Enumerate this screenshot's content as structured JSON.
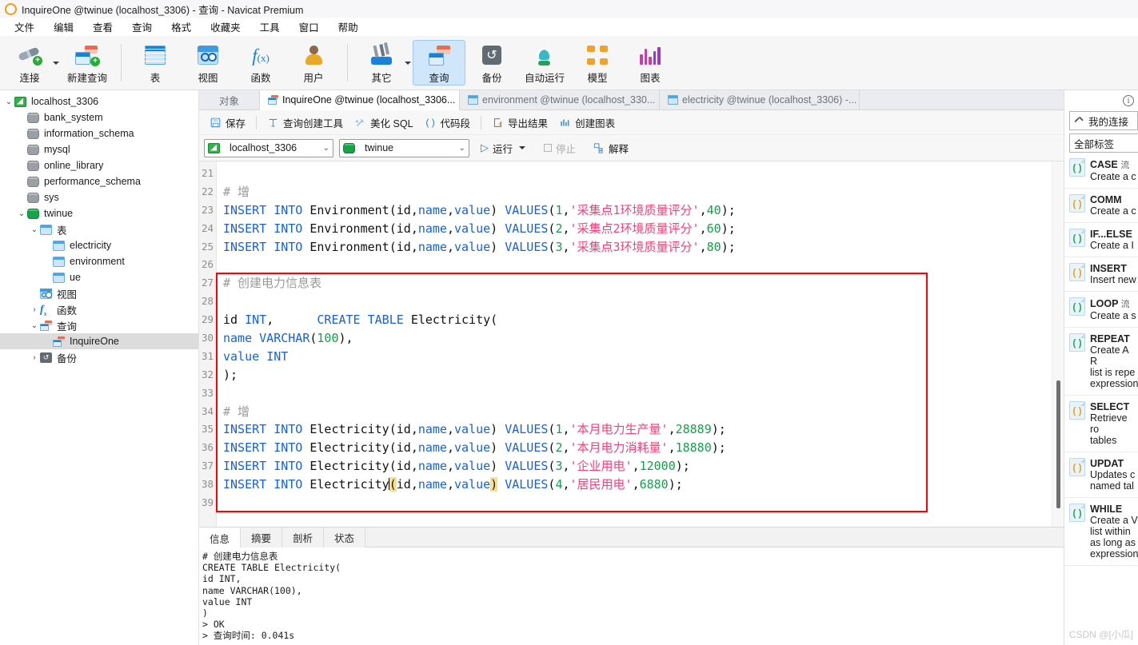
{
  "window": {
    "title": "InquireOne @twinue (localhost_3306) - 查询 - Navicat Premium",
    "logo_icon": "navicat-logo-icon"
  },
  "menubar": {
    "items": [
      {
        "label": "文件"
      },
      {
        "label": "编辑"
      },
      {
        "label": "查看"
      },
      {
        "label": "查询"
      },
      {
        "label": "格式"
      },
      {
        "label": "收藏夹"
      },
      {
        "label": "工具"
      },
      {
        "label": "窗口"
      },
      {
        "label": "帮助"
      }
    ]
  },
  "toolbar": {
    "items": [
      {
        "label": "连接",
        "icon": "connect-icon",
        "has_dropdown": true,
        "selected": false
      },
      {
        "label": "新建查询",
        "icon": "new-query-icon",
        "has_dropdown": false,
        "selected": false
      },
      {
        "label": "表",
        "icon": "table-icon",
        "has_dropdown": false,
        "selected": false
      },
      {
        "label": "视图",
        "icon": "view-icon",
        "has_dropdown": false,
        "selected": false
      },
      {
        "label": "函数",
        "icon": "function-icon",
        "has_dropdown": false,
        "selected": false
      },
      {
        "label": "用户",
        "icon": "user-icon",
        "has_dropdown": false,
        "selected": false
      },
      {
        "label": "其它",
        "icon": "other-tools-icon",
        "has_dropdown": true,
        "selected": false
      },
      {
        "label": "查询",
        "icon": "query-icon",
        "has_dropdown": false,
        "selected": true
      },
      {
        "label": "备份",
        "icon": "backup-icon",
        "has_dropdown": false,
        "selected": false
      },
      {
        "label": "自动运行",
        "icon": "automation-robot-icon",
        "has_dropdown": false,
        "selected": false
      },
      {
        "label": "模型",
        "icon": "model-icon",
        "has_dropdown": false,
        "selected": false
      },
      {
        "label": "图表",
        "icon": "chart-icon",
        "has_dropdown": false,
        "selected": false
      }
    ]
  },
  "sidebar": {
    "nodes": [
      {
        "label": "localhost_3306",
        "indent": 0,
        "twisty": "v",
        "icon": "connection-icon",
        "selected": false
      },
      {
        "label": "bank_system",
        "indent": 1,
        "twisty": "",
        "icon": "database-gray-icon",
        "selected": false
      },
      {
        "label": "information_schema",
        "indent": 1,
        "twisty": "",
        "icon": "database-gray-icon",
        "selected": false
      },
      {
        "label": "mysql",
        "indent": 1,
        "twisty": "",
        "icon": "database-gray-icon",
        "selected": false
      },
      {
        "label": "online_library",
        "indent": 1,
        "twisty": "",
        "icon": "database-gray-icon",
        "selected": false
      },
      {
        "label": "performance_schema",
        "indent": 1,
        "twisty": "",
        "icon": "database-gray-icon",
        "selected": false
      },
      {
        "label": "sys",
        "indent": 1,
        "twisty": "",
        "icon": "database-gray-icon",
        "selected": false
      },
      {
        "label": "twinue",
        "indent": 1,
        "twisty": "v",
        "icon": "database-green-icon",
        "selected": false
      },
      {
        "label": "表",
        "indent": 2,
        "twisty": "v",
        "icon": "table-folder-icon",
        "selected": false
      },
      {
        "label": "electricity",
        "indent": 3,
        "twisty": "",
        "icon": "table-icon",
        "selected": false
      },
      {
        "label": "environment",
        "indent": 3,
        "twisty": "",
        "icon": "table-icon",
        "selected": false
      },
      {
        "label": "ue",
        "indent": 3,
        "twisty": "",
        "icon": "table-icon",
        "selected": false
      },
      {
        "label": "视图",
        "indent": 2,
        "twisty": "",
        "icon": "view-folder-icon",
        "selected": false
      },
      {
        "label": "函数",
        "indent": 2,
        "twisty": ">",
        "icon": "function-folder-icon",
        "selected": false
      },
      {
        "label": "查询",
        "indent": 2,
        "twisty": "v",
        "icon": "query-folder-icon",
        "selected": false
      },
      {
        "label": "InquireOne",
        "indent": 3,
        "twisty": "",
        "icon": "query-icon",
        "selected": true
      },
      {
        "label": "备份",
        "indent": 2,
        "twisty": ">",
        "icon": "backup-folder-icon",
        "selected": false
      }
    ]
  },
  "tabs": {
    "object_tab": "对象",
    "items": [
      {
        "label": "InquireOne @twinue (localhost_3306...",
        "icon": "query-icon",
        "active": true
      },
      {
        "label": "environment @twinue (localhost_330...",
        "icon": "table-icon",
        "active": false
      },
      {
        "label": "electricity @twinue (localhost_3306) -...",
        "icon": "table-icon",
        "active": false
      }
    ]
  },
  "query_toolbar": {
    "buttons": [
      {
        "label": "保存",
        "icon": "save-icon"
      },
      {
        "label": "查询创建工具",
        "icon": "query-builder-icon"
      },
      {
        "label": "美化 SQL",
        "icon": "beautify-sql-icon"
      },
      {
        "label": "代码段",
        "icon": "code-snippet-icon"
      },
      {
        "label": "导出结果",
        "icon": "export-result-icon"
      },
      {
        "label": "创建图表",
        "icon": "create-chart-icon"
      }
    ],
    "connection_select": {
      "value": "localhost_3306",
      "icon": "connection-icon"
    },
    "database_select": {
      "value": "twinue",
      "icon": "database-green-icon"
    },
    "run_label": "运行",
    "stop_label": "停止",
    "explain_label": "解释"
  },
  "editor": {
    "first_line": 21,
    "last_line": 39,
    "lines": [
      {
        "n": 21,
        "tokens": []
      },
      {
        "n": 22,
        "tokens": [
          {
            "t": "# 增",
            "c": "cmt"
          }
        ]
      },
      {
        "n": 23,
        "tokens": [
          {
            "t": "INSERT INTO ",
            "c": "kw"
          },
          {
            "t": "Environment(",
            "c": "pl"
          },
          {
            "t": "id",
            "c": "pl"
          },
          {
            "t": ",",
            "c": "pl"
          },
          {
            "t": "name",
            "c": "col"
          },
          {
            "t": ",",
            "c": "pl"
          },
          {
            "t": "value",
            "c": "col"
          },
          {
            "t": ") ",
            "c": "pl"
          },
          {
            "t": "VALUES",
            "c": "kw"
          },
          {
            "t": "(",
            "c": "pl"
          },
          {
            "t": "1",
            "c": "num"
          },
          {
            "t": ",",
            "c": "pl"
          },
          {
            "t": "'采集点1环境质量评分'",
            "c": "str"
          },
          {
            "t": ",",
            "c": "pl"
          },
          {
            "t": "40",
            "c": "num"
          },
          {
            "t": ");",
            "c": "pl"
          }
        ]
      },
      {
        "n": 24,
        "tokens": [
          {
            "t": "INSERT INTO ",
            "c": "kw"
          },
          {
            "t": "Environment(",
            "c": "pl"
          },
          {
            "t": "id",
            "c": "pl"
          },
          {
            "t": ",",
            "c": "pl"
          },
          {
            "t": "name",
            "c": "col"
          },
          {
            "t": ",",
            "c": "pl"
          },
          {
            "t": "value",
            "c": "col"
          },
          {
            "t": ") ",
            "c": "pl"
          },
          {
            "t": "VALUES",
            "c": "kw"
          },
          {
            "t": "(",
            "c": "pl"
          },
          {
            "t": "2",
            "c": "num"
          },
          {
            "t": ",",
            "c": "pl"
          },
          {
            "t": "'采集点2环境质量评分'",
            "c": "str"
          },
          {
            "t": ",",
            "c": "pl"
          },
          {
            "t": "60",
            "c": "num"
          },
          {
            "t": ");",
            "c": "pl"
          }
        ]
      },
      {
        "n": 25,
        "tokens": [
          {
            "t": "INSERT INTO ",
            "c": "kw"
          },
          {
            "t": "Environment(",
            "c": "pl"
          },
          {
            "t": "id",
            "c": "pl"
          },
          {
            "t": ",",
            "c": "pl"
          },
          {
            "t": "name",
            "c": "col"
          },
          {
            "t": ",",
            "c": "pl"
          },
          {
            "t": "value",
            "c": "col"
          },
          {
            "t": ") ",
            "c": "pl"
          },
          {
            "t": "VALUES",
            "c": "kw"
          },
          {
            "t": "(",
            "c": "pl"
          },
          {
            "t": "3",
            "c": "num"
          },
          {
            "t": ",",
            "c": "pl"
          },
          {
            "t": "'采集点3环境质量评分'",
            "c": "str"
          },
          {
            "t": ",",
            "c": "pl"
          },
          {
            "t": "80",
            "c": "num"
          },
          {
            "t": ");",
            "c": "pl"
          }
        ]
      },
      {
        "n": 26,
        "tokens": []
      },
      {
        "n": 27,
        "tokens": [
          {
            "t": "# 创建电力信息表",
            "c": "cmt"
          }
        ]
      },
      {
        "n": 28,
        "tokens": [
          {
            "t": "CREATE TABLE ",
            "c": "kw"
          },
          {
            "t": "Electricity(",
            "c": "pl"
          }
        ]
      },
      {
        "n": 29,
        "tokens": [
          {
            "t": "id ",
            "c": "pl"
          },
          {
            "t": "INT",
            "c": "kw"
          },
          {
            "t": ",",
            "c": "pl"
          }
        ]
      },
      {
        "n": 30,
        "tokens": [
          {
            "t": "name ",
            "c": "col"
          },
          {
            "t": "VARCHAR",
            "c": "kw"
          },
          {
            "t": "(",
            "c": "pl"
          },
          {
            "t": "100",
            "c": "num"
          },
          {
            "t": "),",
            "c": "pl"
          }
        ]
      },
      {
        "n": 31,
        "tokens": [
          {
            "t": "value ",
            "c": "col"
          },
          {
            "t": "INT",
            "c": "kw"
          }
        ]
      },
      {
        "n": 32,
        "tokens": [
          {
            "t": ");",
            "c": "pl"
          }
        ]
      },
      {
        "n": 33,
        "tokens": []
      },
      {
        "n": 34,
        "tokens": [
          {
            "t": "# 增",
            "c": "cmt"
          }
        ]
      },
      {
        "n": 35,
        "tokens": [
          {
            "t": "INSERT INTO ",
            "c": "kw"
          },
          {
            "t": "Electricity(",
            "c": "pl"
          },
          {
            "t": "id",
            "c": "pl"
          },
          {
            "t": ",",
            "c": "pl"
          },
          {
            "t": "name",
            "c": "col"
          },
          {
            "t": ",",
            "c": "pl"
          },
          {
            "t": "value",
            "c": "col"
          },
          {
            "t": ") ",
            "c": "pl"
          },
          {
            "t": "VALUES",
            "c": "kw"
          },
          {
            "t": "(",
            "c": "pl"
          },
          {
            "t": "1",
            "c": "num"
          },
          {
            "t": ",",
            "c": "pl"
          },
          {
            "t": "'本月电力生产量'",
            "c": "str"
          },
          {
            "t": ",",
            "c": "pl"
          },
          {
            "t": "28889",
            "c": "num"
          },
          {
            "t": ");",
            "c": "pl"
          }
        ]
      },
      {
        "n": 36,
        "tokens": [
          {
            "t": "INSERT INTO ",
            "c": "kw"
          },
          {
            "t": "Electricity(",
            "c": "pl"
          },
          {
            "t": "id",
            "c": "pl"
          },
          {
            "t": ",",
            "c": "pl"
          },
          {
            "t": "name",
            "c": "col"
          },
          {
            "t": ",",
            "c": "pl"
          },
          {
            "t": "value",
            "c": "col"
          },
          {
            "t": ") ",
            "c": "pl"
          },
          {
            "t": "VALUES",
            "c": "kw"
          },
          {
            "t": "(",
            "c": "pl"
          },
          {
            "t": "2",
            "c": "num"
          },
          {
            "t": ",",
            "c": "pl"
          },
          {
            "t": "'本月电力消耗量'",
            "c": "str"
          },
          {
            "t": ",",
            "c": "pl"
          },
          {
            "t": "18880",
            "c": "num"
          },
          {
            "t": ");",
            "c": "pl"
          }
        ]
      },
      {
        "n": 37,
        "tokens": [
          {
            "t": "INSERT INTO ",
            "c": "kw"
          },
          {
            "t": "Electricity(",
            "c": "pl"
          },
          {
            "t": "id",
            "c": "pl"
          },
          {
            "t": ",",
            "c": "pl"
          },
          {
            "t": "name",
            "c": "col"
          },
          {
            "t": ",",
            "c": "pl"
          },
          {
            "t": "value",
            "c": "col"
          },
          {
            "t": ") ",
            "c": "pl"
          },
          {
            "t": "VALUES",
            "c": "kw"
          },
          {
            "t": "(",
            "c": "pl"
          },
          {
            "t": "3",
            "c": "num"
          },
          {
            "t": ",",
            "c": "pl"
          },
          {
            "t": "'企业用电'",
            "c": "str"
          },
          {
            "t": ",",
            "c": "pl"
          },
          {
            "t": "12000",
            "c": "num"
          },
          {
            "t": ");",
            "c": "pl"
          }
        ]
      },
      {
        "n": 38,
        "tokens": [
          {
            "t": "INSERT INTO ",
            "c": "kw"
          },
          {
            "t": "Electricity",
            "c": "pl"
          },
          {
            "t": "CARET",
            "c": "caret"
          },
          {
            "t": "(",
            "c": "pmatch"
          },
          {
            "t": "id",
            "c": "pl"
          },
          {
            "t": ",",
            "c": "pl"
          },
          {
            "t": "name",
            "c": "col"
          },
          {
            "t": ",",
            "c": "pl"
          },
          {
            "t": "value",
            "c": "col"
          },
          {
            "t": ")",
            "c": "pmatch"
          },
          {
            "t": " ",
            "c": "pl"
          },
          {
            "t": "VALUES",
            "c": "kw"
          },
          {
            "t": "(",
            "c": "pl"
          },
          {
            "t": "4",
            "c": "num"
          },
          {
            "t": ",",
            "c": "pl"
          },
          {
            "t": "'居民用电'",
            "c": "str"
          },
          {
            "t": ",",
            "c": "pl"
          },
          {
            "t": "6880",
            "c": "num"
          },
          {
            "t": ");",
            "c": "pl"
          }
        ]
      },
      {
        "n": 39,
        "tokens": []
      }
    ],
    "fold_marker_line": 28,
    "annotation_box_color": "#ff0000"
  },
  "results": {
    "tabs": [
      {
        "label": "信息",
        "active": true
      },
      {
        "label": "摘要",
        "active": false
      },
      {
        "label": "剖析",
        "active": false
      },
      {
        "label": "状态",
        "active": false
      }
    ],
    "output_lines": [
      "# 创建电力信息表",
      "CREATE TABLE Electricity(",
      "id INT,",
      "name VARCHAR(100),",
      "value INT",
      ")",
      "> OK",
      "> 查询时间: 0.041s"
    ]
  },
  "right_panel": {
    "info_icon": "info-icon",
    "my_connection_label": "我的连接",
    "all_tags_label": "全部标签",
    "snippets": [
      {
        "title": "CASE",
        "sub": "流",
        "desc": "Create a c",
        "color": "#2aaa52"
      },
      {
        "title": "COMM",
        "sub": "",
        "desc": "Create a c",
        "color": "#e2a720"
      },
      {
        "title": "IF...ELSE",
        "sub": "",
        "desc": "Create a I",
        "color": "#2aaa52"
      },
      {
        "title": "INSERT",
        "sub": "",
        "desc": "Insert new",
        "color": "#e2a720"
      },
      {
        "title": "LOOP",
        "sub": "流",
        "desc": "Create a s",
        "color": "#2aaa52"
      },
      {
        "title": "REPEAT",
        "sub": "",
        "desc": "Create A R\nlist is repe\nexpression",
        "color": "#2aaa52"
      },
      {
        "title": "SELECT",
        "sub": "",
        "desc": "Retrieve ro\ntables",
        "color": "#e2a720"
      },
      {
        "title": "UPDAT",
        "sub": "",
        "desc": "Updates c\nnamed tal",
        "color": "#e2a720"
      },
      {
        "title": "WHILE",
        "sub": "",
        "desc": "Create a V\nlist within\nas long as\nexpression",
        "color": "#2aaa52"
      }
    ]
  },
  "watermark": "CSDN @[小瓜]"
}
